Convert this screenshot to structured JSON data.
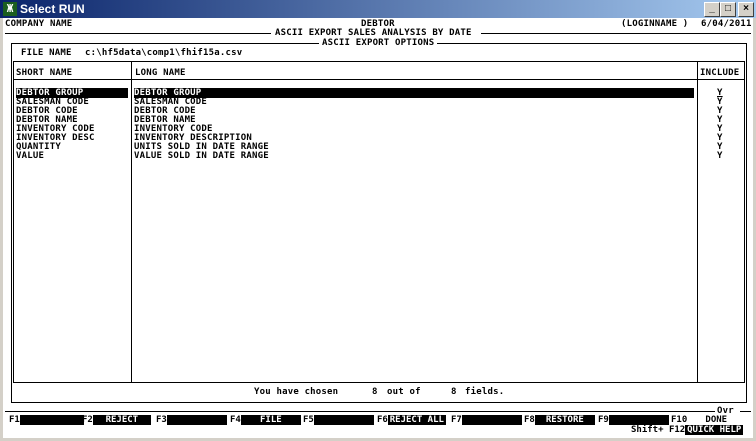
{
  "window": {
    "title": "Select RUN",
    "minimize": "_",
    "maximize": "□",
    "close": "×"
  },
  "header": {
    "company": "COMPANY NAME",
    "module": "DEBTOR",
    "login": "(LOGINNAME )",
    "date": "6/04/2011",
    "report": "ASCII EXPORT SALES ANALYSIS BY DATE",
    "panel": "ASCII EXPORT OPTIONS"
  },
  "file": {
    "label": "FILE NAME",
    "value": "c:\\hf5data\\comp1\\fhif15a.csv"
  },
  "columns": {
    "short": "SHORT NAME",
    "long": "LONG NAME",
    "include": "INCLUDE"
  },
  "rows": [
    {
      "short": "DEBTOR GROUP",
      "long": "DEBTOR GROUP",
      "include": "Y"
    },
    {
      "short": "SALESMAN CODE",
      "long": "SALESMAN CODE",
      "include": "Y"
    },
    {
      "short": "DEBTOR CODE",
      "long": "DEBTOR CODE",
      "include": "Y"
    },
    {
      "short": "DEBTOR NAME",
      "long": "DEBTOR NAME",
      "include": "Y"
    },
    {
      "short": "INVENTORY CODE",
      "long": "INVENTORY CODE",
      "include": "Y"
    },
    {
      "short": "INVENTORY DESC",
      "long": "INVENTORY DESCRIPTION",
      "include": "Y"
    },
    {
      "short": "QUANTITY",
      "long": "UNITS SOLD IN DATE RANGE",
      "include": "Y"
    },
    {
      "short": "VALUE",
      "long": "VALUE SOLD IN DATE RANGE",
      "include": "Y"
    }
  ],
  "summary": {
    "prefix": "You have chosen",
    "chosen": "8",
    "mid": "out of",
    "total": "8",
    "suffix": "fields."
  },
  "ovr": "Ovr",
  "fkeys": [
    {
      "key": "F1",
      "label": ""
    },
    {
      "key": "F2",
      "label": "REJECT"
    },
    {
      "key": "F3",
      "label": ""
    },
    {
      "key": "F4",
      "label": "FILE"
    },
    {
      "key": "F5",
      "label": ""
    },
    {
      "key": "F6",
      "label": "REJECT ALL"
    },
    {
      "key": "F7",
      "label": ""
    },
    {
      "key": "F8",
      "label": "RESTORE"
    },
    {
      "key": "F9",
      "label": ""
    },
    {
      "key": "F10",
      "label": "DONE"
    }
  ],
  "shift": {
    "prefix": "Shift+",
    "key": "F12",
    "label": "QUICK HELP"
  }
}
